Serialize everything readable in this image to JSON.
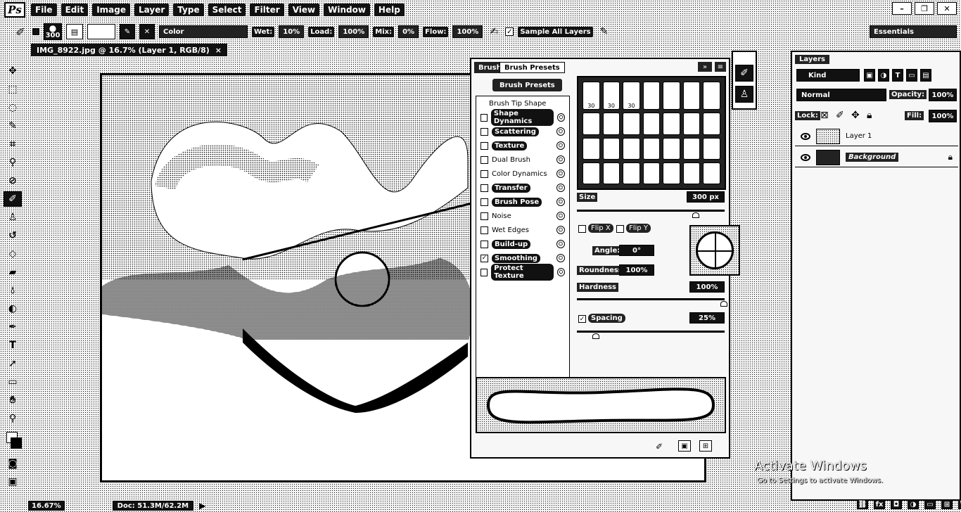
{
  "app": {
    "logo": "Ps"
  },
  "menu": [
    "File",
    "Edit",
    "Image",
    "Layer",
    "Type",
    "Select",
    "Filter",
    "View",
    "Window",
    "Help"
  ],
  "window_controls": [
    "–",
    "❐",
    "✕"
  ],
  "options": {
    "brush_size": "300",
    "mode_value": "Color",
    "wet_label": "Wet:",
    "wet_value": "10%",
    "load_label": "Load:",
    "load_value": "100%",
    "mix_label": "Mix:",
    "mix_value": "0%",
    "flow_label": "Flow:",
    "flow_value": "100%",
    "sample_all_layers": "Sample All Layers",
    "workspace": "Essentials"
  },
  "document": {
    "tab_title": "IMG_8922.jpg @ 16.7% (Layer 1, RGB/8)"
  },
  "brush_panel": {
    "tabs": [
      "Brush",
      "Brush Presets"
    ],
    "presets_button": "Brush Presets",
    "tip_shape": "Brush Tip Shape",
    "items": [
      {
        "label": "Shape Dynamics",
        "checked": false,
        "strong": true
      },
      {
        "label": "Scattering",
        "checked": false,
        "strong": true
      },
      {
        "label": "Texture",
        "checked": false,
        "strong": true
      },
      {
        "label": "Dual Brush",
        "checked": false,
        "strong": false
      },
      {
        "label": "Color Dynamics",
        "checked": false,
        "strong": false
      },
      {
        "label": "Transfer",
        "checked": false,
        "strong": true
      },
      {
        "label": "Brush Pose",
        "checked": false,
        "strong": true
      },
      {
        "label": "Noise",
        "checked": false,
        "strong": false
      },
      {
        "label": "Wet Edges",
        "checked": false,
        "strong": false
      },
      {
        "label": "Build-up",
        "checked": false,
        "strong": true
      },
      {
        "label": "Smoothing",
        "checked": true,
        "strong": true
      },
      {
        "label": "Protect Texture",
        "checked": false,
        "strong": true
      }
    ],
    "preset_numbers": [
      "30",
      "30",
      "30"
    ],
    "size_label": "Size",
    "size_value": "300 px",
    "flip_x": "Flip X",
    "flip_y": "Flip Y",
    "angle_label": "Angle:",
    "angle_value": "0°",
    "roundness_label": "Roundness:",
    "roundness_value": "100%",
    "hardness_label": "Hardness",
    "hardness_value": "100%",
    "spacing_label": "Spacing",
    "spacing_value": "25%"
  },
  "layers_panel": {
    "tab": "Layers",
    "kind": "Kind",
    "blend_mode": "Normal",
    "opacity_label": "Opacity:",
    "opacity_value": "100%",
    "lock_label": "Lock:",
    "fill_label": "Fill:",
    "fill_value": "100%",
    "layers": [
      {
        "name": "Layer 1",
        "locked": false
      },
      {
        "name": "Background",
        "locked": true
      }
    ]
  },
  "status": {
    "zoom": "16.67%",
    "doc": "Doc: 51.3M/62.2M"
  },
  "watermark": {
    "title": "Activate Windows",
    "subtitle": "Go to Settings to activate Windows."
  }
}
